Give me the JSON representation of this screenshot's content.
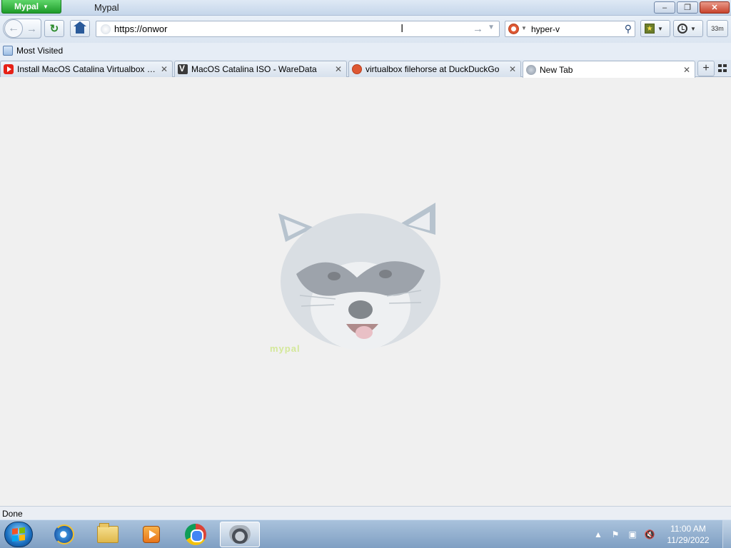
{
  "window": {
    "app_menu_label": "Mypal",
    "title": "Mypal",
    "minimize_label": "–",
    "maximize_label": "❐",
    "close_label": "✕"
  },
  "toolbar": {
    "back_glyph": "←",
    "forward_glyph": "→",
    "reload_glyph": "↻",
    "url_value": "https://onwor",
    "go_glyph": "→",
    "dropdown_glyph": "▼",
    "search_engine_icon": "duckduckgo-icon",
    "search_value": "hyper-v",
    "search_glyph": "⚲",
    "bookmark_caret": "▼",
    "history_caret": "▼",
    "memory_label": "33m"
  },
  "bookmarks_bar": {
    "items": [
      {
        "label": "Most Visited",
        "icon": "bookmark-folder-icon"
      }
    ]
  },
  "tabs": [
    {
      "label": "Install MacOS Catalina Virtualbox 10...",
      "icon": "youtube-icon",
      "active": false
    },
    {
      "label": "MacOS Catalina ISO - WareData",
      "icon": "waredata-icon",
      "active": false
    },
    {
      "label": "virtualbox filehorse at DuckDuckGo",
      "icon": "duckduckgo-icon",
      "active": false
    },
    {
      "label": "New Tab",
      "icon": "globe-icon",
      "active": true
    }
  ],
  "tab_close_glyph": "✕",
  "new_tab_glyph": "+",
  "content": {
    "mascot": "raccoon-mascot-image",
    "mascot_caption": "mypal"
  },
  "status": {
    "text": "Done"
  },
  "taskbar": {
    "apps": [
      {
        "name": "internet-explorer",
        "active": false
      },
      {
        "name": "file-explorer",
        "active": false
      },
      {
        "name": "media-player",
        "active": false
      },
      {
        "name": "chrome",
        "active": false
      },
      {
        "name": "mypal",
        "active": true
      }
    ],
    "tray": {
      "show_hidden_glyph": "▲",
      "time": "11:00 AM",
      "date": "11/29/2022"
    }
  },
  "colors": {
    "titlebar": "#c5d6ea",
    "app_menu_green": "#1e9b2a",
    "content_bg": "#f0f0f0",
    "taskbar": "#8fadcf"
  }
}
